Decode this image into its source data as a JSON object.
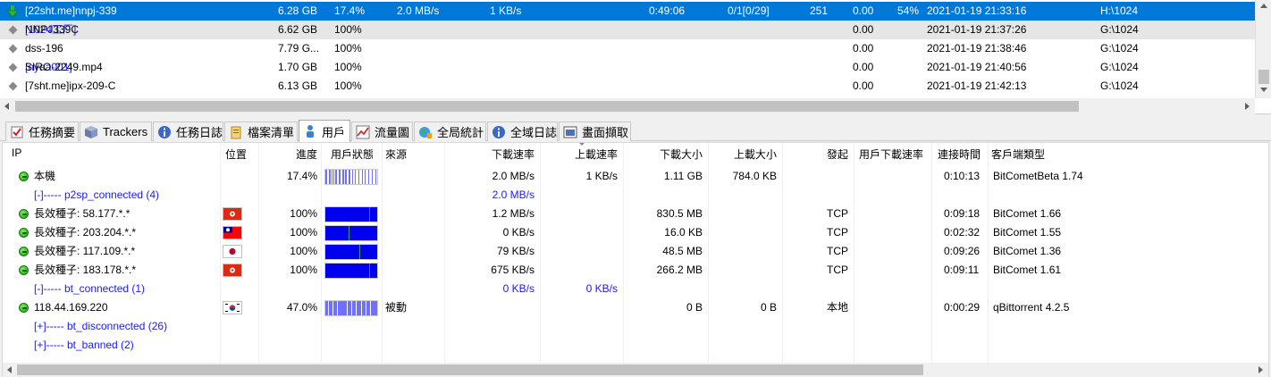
{
  "tasks": [
    {
      "name": "[22sht.me]nnpj-339",
      "tag": "",
      "size": "6.28 GB",
      "progress": "17.4%",
      "dl_speed": "2.0 MB/s",
      "ul_speed": "1 KB/s",
      "eta": "0:49:06",
      "seeds": "0/1[0/29]",
      "peers": "251",
      "ratio": "0.00",
      "health": "54%",
      "added": "2021-01-19 21:33:16",
      "path": "H:\\1024",
      "state": "downloading",
      "selected": true
    },
    {
      "name": "NNPJ339C ",
      "tag": "[1024工厂]",
      "size": "6.62 GB",
      "progress": "100%",
      "dl_speed": "",
      "ul_speed": "",
      "eta": "",
      "seeds": "",
      "peers": "",
      "ratio": "0.00",
      "health": "",
      "added": "2021-01-19 21:37:26",
      "path": "G:\\1024",
      "state": "complete"
    },
    {
      "name": "dss-196",
      "tag": "",
      "size": "7.79 G...",
      "progress": "100%",
      "dl_speed": "",
      "ul_speed": "",
      "eta": "",
      "seeds": "",
      "peers": "",
      "ratio": "0.00",
      "health": "",
      "added": "2021-01-19 21:38:46",
      "path": "G:\\1024",
      "state": "complete"
    },
    {
      "name": "SIRO-2249.mp4 ",
      "tag": "[nyaa001]",
      "size": "1.70 GB",
      "progress": "100%",
      "dl_speed": "",
      "ul_speed": "",
      "eta": "",
      "seeds": "",
      "peers": "",
      "ratio": "0.00",
      "health": "",
      "added": "2021-01-19 21:40:56",
      "path": "G:\\1024",
      "state": "complete"
    },
    {
      "name": "[7sht.me]ipx-209-C",
      "tag": "",
      "size": "6.13 GB",
      "progress": "100%",
      "dl_speed": "",
      "ul_speed": "",
      "eta": "",
      "seeds": "",
      "peers": "",
      "ratio": "0.00",
      "health": "",
      "added": "2021-01-19 21:42:13",
      "path": "G:\\1024",
      "state": "complete"
    }
  ],
  "tabs": [
    {
      "label": "任務摘要",
      "icon": "summary-icon"
    },
    {
      "label": "Trackers",
      "icon": "trackers-icon"
    },
    {
      "label": "任務日誌",
      "icon": "info-icon"
    },
    {
      "label": "檔案清單",
      "icon": "files-icon"
    },
    {
      "label": "用戶",
      "icon": "users-icon",
      "active": true
    },
    {
      "label": "流量圖",
      "icon": "chart-icon"
    },
    {
      "label": "全局統計",
      "icon": "globe-icon"
    },
    {
      "label": "全域日誌",
      "icon": "info-icon"
    },
    {
      "label": "畫面擷取",
      "icon": "screenshot-icon"
    }
  ],
  "peer_headers": {
    "ip": "IP",
    "location": "位置",
    "progress": "進度",
    "status": "用戶狀態",
    "source": "來源",
    "dl_speed": "下載速率",
    "ul_speed": "上載速率",
    "downloaded": "下載大小",
    "uploaded": "上載大小",
    "initiated": "發起",
    "peer_dl_speed": "用戶下載速率",
    "conn_time": "連接時間",
    "client": "客戶端類型"
  },
  "peers": [
    {
      "kind": "peer",
      "ip": "本機",
      "flag": "",
      "progress": "17.4%",
      "bar": {
        "type": "striped",
        "fill": 0.174
      },
      "source": "",
      "dl_speed": "2.0 MB/s",
      "ul_speed": "1 KB/s",
      "downloaded": "1.11 GB",
      "uploaded": "784.0 KB",
      "initiated": "",
      "peer_dl_speed": "",
      "conn_time": "0:10:13",
      "client": "BitCometBeta 1.74"
    },
    {
      "kind": "group",
      "label": "[-]----- p2sp_connected (4)",
      "dl_speed": "2.0 MB/s",
      "ul_speed": ""
    },
    {
      "kind": "peer",
      "ip": "長效種子: 58.177.*.*",
      "flag": "hk",
      "progress": "100%",
      "bar": {
        "type": "solid",
        "fill": 1.0
      },
      "source": "",
      "dl_speed": "1.2 MB/s",
      "ul_speed": "",
      "downloaded": "830.5 MB",
      "uploaded": "",
      "initiated": "TCP",
      "peer_dl_speed": "",
      "conn_time": "0:09:18",
      "client": "BitComet 1.66"
    },
    {
      "kind": "peer",
      "ip": "長效種子: 203.204.*.*",
      "flag": "tw",
      "progress": "100%",
      "bar": {
        "type": "solid",
        "fill": 1.0
      },
      "source": "",
      "dl_speed": "0 KB/s",
      "ul_speed": "",
      "downloaded": "16.0 KB",
      "uploaded": "",
      "initiated": "TCP",
      "peer_dl_speed": "",
      "conn_time": "0:02:32",
      "client": "BitComet 1.55"
    },
    {
      "kind": "peer",
      "ip": "長效種子: 117.109.*.*",
      "flag": "jp",
      "progress": "100%",
      "bar": {
        "type": "solid",
        "fill": 1.0
      },
      "source": "",
      "dl_speed": "79 KB/s",
      "ul_speed": "",
      "downloaded": "48.5 MB",
      "uploaded": "",
      "initiated": "TCP",
      "peer_dl_speed": "",
      "conn_time": "0:09:26",
      "client": "BitComet 1.36"
    },
    {
      "kind": "peer",
      "ip": "長效種子: 183.178.*.*",
      "flag": "hk",
      "progress": "100%",
      "bar": {
        "type": "solid",
        "fill": 1.0
      },
      "source": "",
      "dl_speed": "675 KB/s",
      "ul_speed": "",
      "downloaded": "266.2 MB",
      "uploaded": "",
      "initiated": "TCP",
      "peer_dl_speed": "",
      "conn_time": "0:09:11",
      "client": "BitComet 1.61"
    },
    {
      "kind": "group",
      "label": "[-]----- bt_connected (1)",
      "dl_speed": "0 KB/s",
      "ul_speed": "0 KB/s"
    },
    {
      "kind": "peer",
      "ip": "118.44.169.220",
      "flag": "kr",
      "progress": "47.0%",
      "bar": {
        "type": "striped",
        "fill": 0.47
      },
      "source": "被動",
      "dl_speed": "",
      "ul_speed": "",
      "downloaded": "0 B",
      "uploaded": "0 B",
      "initiated": "本地",
      "peer_dl_speed": "",
      "conn_time": "0:00:29",
      "client": "qBittorrent 4.2.5"
    },
    {
      "kind": "group",
      "label": "[+]----- bt_disconnected (26)",
      "dl_speed": "",
      "ul_speed": ""
    },
    {
      "kind": "group",
      "label": "[+]----- bt_banned (2)",
      "dl_speed": "",
      "ul_speed": ""
    }
  ],
  "colors": {
    "selection": "#0078d7",
    "link_blue": "#1a1aff",
    "bar_blue": "#0000ee",
    "bar_stripe": "#7070ff"
  }
}
